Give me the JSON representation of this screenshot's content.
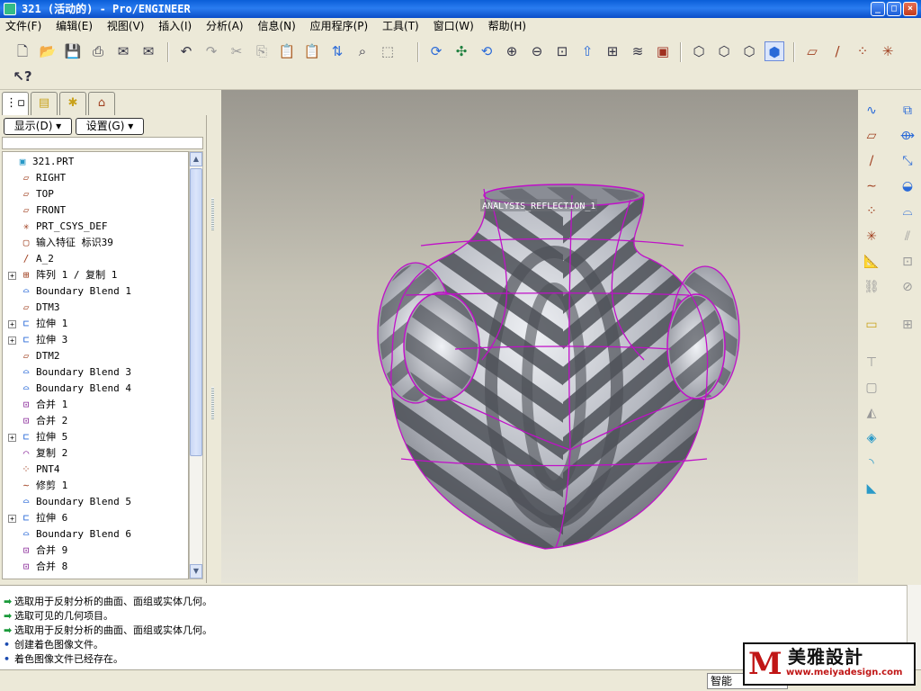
{
  "window": {
    "title": "321 (活动的) - Pro/ENGINEER",
    "controls": [
      "_",
      "□",
      "×"
    ]
  },
  "menu": [
    "文件(F)",
    "编辑(E)",
    "视图(V)",
    "插入(I)",
    "分析(A)",
    "信息(N)",
    "应用程序(P)",
    "工具(T)",
    "窗口(W)",
    "帮助(H)"
  ],
  "toolbar": {
    "row1_icons": [
      "new-icon",
      "open-icon",
      "save-icon",
      "print-icon",
      "email-icon",
      "email-link-icon",
      "undo-icon",
      "redo-icon",
      "cut-icon",
      "copy-icon",
      "paste-icon",
      "paste-special-icon",
      "regenerate-icon",
      "find-icon",
      "select-box-icon",
      "repaint-icon",
      "spin-center-icon",
      "orient-icon",
      "zoom-in-icon",
      "zoom-out-icon",
      "refit-icon",
      "reorient-icon",
      "saved-views-icon",
      "layers-icon",
      "view-manager-icon",
      "wireframe-icon",
      "hidden-line-icon",
      "no-hidden-icon",
      "shading-icon",
      "datum-planes-icon",
      "datum-axes-icon",
      "datum-points-icon",
      "coord-sys-icon"
    ],
    "row2_icons": [
      "context-help-icon"
    ]
  },
  "left_tabs": [
    "model-tree-tab",
    "layers-tab",
    "favorites-tab",
    "connections-tab"
  ],
  "panel": {
    "show_label": "显示(D) ▾",
    "settings_label": "设置(G) ▾"
  },
  "tree": {
    "items": [
      {
        "label": "321.PRT",
        "icon": "part-icon",
        "expand": false
      },
      {
        "label": "RIGHT",
        "icon": "datum-plane-icon",
        "expand": false
      },
      {
        "label": "TOP",
        "icon": "datum-plane-icon",
        "expand": false
      },
      {
        "label": "FRONT",
        "icon": "datum-plane-icon",
        "expand": false
      },
      {
        "label": "PRT_CSYS_DEF",
        "icon": "csys-icon",
        "expand": false
      },
      {
        "label": "输入特征 标识39",
        "icon": "import-feature-icon",
        "expand": false
      },
      {
        "label": "A_2",
        "icon": "datum-axis-icon",
        "expand": false
      },
      {
        "label": "阵列 1 / 复制 1",
        "icon": "pattern-icon",
        "expand": true
      },
      {
        "label": "Boundary Blend 1",
        "icon": "boundary-blend-icon",
        "expand": false
      },
      {
        "label": "DTM3",
        "icon": "datum-plane-icon",
        "expand": false
      },
      {
        "label": "拉伸 1",
        "icon": "extrude-icon",
        "expand": true
      },
      {
        "label": "拉伸 3",
        "icon": "extrude-icon",
        "expand": true
      },
      {
        "label": "DTM2",
        "icon": "datum-plane-icon",
        "expand": false
      },
      {
        "label": "Boundary Blend 3",
        "icon": "boundary-blend-icon",
        "expand": false
      },
      {
        "label": "Boundary Blend 4",
        "icon": "boundary-blend-icon",
        "expand": false
      },
      {
        "label": "合并 1",
        "icon": "merge-icon",
        "expand": false
      },
      {
        "label": "合并 2",
        "icon": "merge-icon",
        "expand": false
      },
      {
        "label": "拉伸 5",
        "icon": "extrude-icon",
        "expand": true
      },
      {
        "label": "复制 2",
        "icon": "copy-feature-icon",
        "expand": false
      },
      {
        "label": "PNT4",
        "icon": "datum-point-icon",
        "expand": false
      },
      {
        "label": "修剪 1",
        "icon": "trim-icon",
        "expand": false
      },
      {
        "label": "Boundary Blend 5",
        "icon": "boundary-blend-icon",
        "expand": false
      },
      {
        "label": "拉伸 6",
        "icon": "extrude-icon",
        "expand": true
      },
      {
        "label": "Boundary Blend 6",
        "icon": "boundary-blend-icon",
        "expand": false
      },
      {
        "label": "合并 9",
        "icon": "merge-icon",
        "expand": false
      },
      {
        "label": "合并 8",
        "icon": "merge-icon",
        "expand": false
      }
    ]
  },
  "viewport": {
    "analysis_label": "ANALYSIS_REFLECTION_1"
  },
  "right_toolbar_icons": [
    "sketch-datum-curve-icon",
    "datum-plane-tool-icon",
    "datum-axis-tool-icon",
    "datum-curve-icon",
    "datum-point-tool-icon",
    "csys-tool-icon",
    "analysis-feature-icon",
    "variable-section-icon",
    "style-icon",
    "boundary-blend-tool-icon",
    "blend-icon",
    "extrude-tool-icon",
    "hole-icon",
    "shell-icon",
    "rib-icon",
    "draft-icon",
    "round-icon",
    "chamfer-icon"
  ],
  "messages": [
    {
      "type": "prompt",
      "text": "选取用于反射分析的曲面、面组或实体几何。"
    },
    {
      "type": "prompt",
      "text": "选取可见的几何项目。"
    },
    {
      "type": "prompt",
      "text": "选取用于反射分析的曲面、面组或实体几何。"
    },
    {
      "type": "info",
      "text": "创建着色图像文件。"
    },
    {
      "type": "info",
      "text": "着色图像文件已经存在。"
    }
  ],
  "status": {
    "filter": "智能"
  },
  "watermark": {
    "mark": "M",
    "name": "美雅設計",
    "url": "www.meiyadesign.com"
  },
  "colors": {
    "titlebar": "#0a5ed8",
    "edge_highlight": "#c010c8",
    "model_dark": "#5c5f66",
    "model_light": "#e6e8ee"
  }
}
